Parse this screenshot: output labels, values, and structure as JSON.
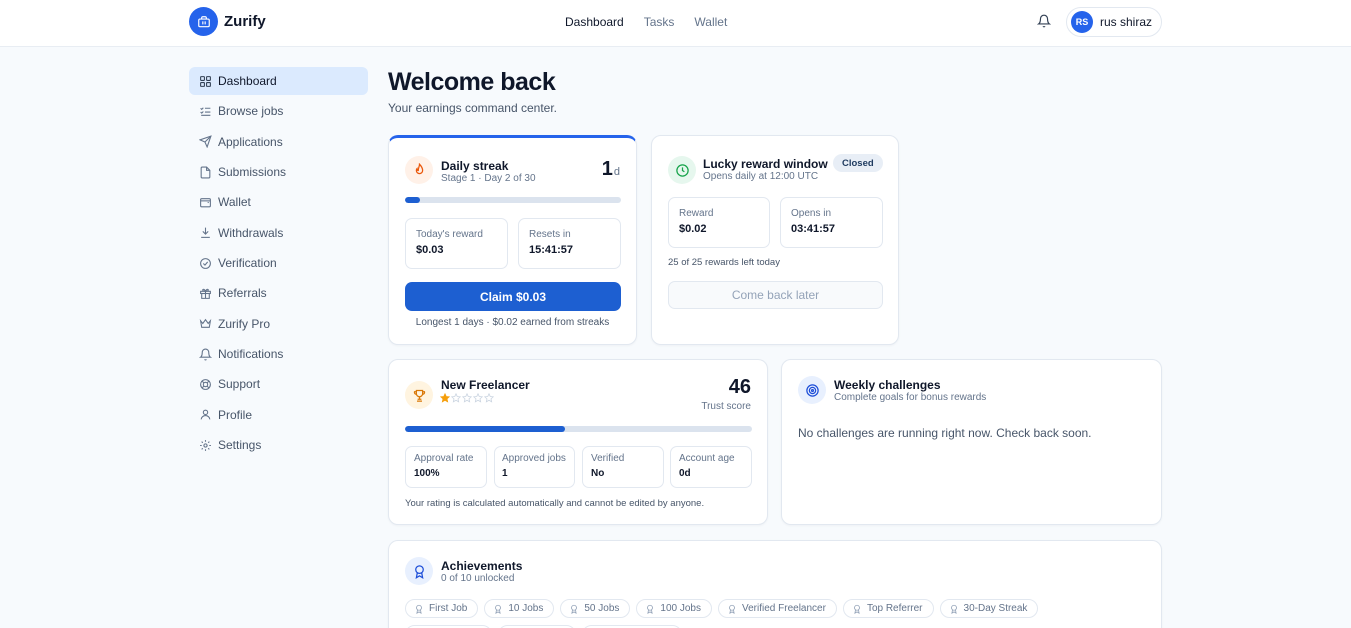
{
  "app": {
    "name": "Zurify"
  },
  "topnav": {
    "items": [
      "Dashboard",
      "Tasks",
      "Wallet"
    ],
    "active": 0
  },
  "user": {
    "initials": "RS",
    "name": "rus shiraz"
  },
  "sidebar": {
    "items": [
      {
        "label": "Dashboard",
        "icon": "grid-icon"
      },
      {
        "label": "Browse jobs",
        "icon": "list-check-icon"
      },
      {
        "label": "Applications",
        "icon": "send-icon"
      },
      {
        "label": "Submissions",
        "icon": "file-icon"
      },
      {
        "label": "Wallet",
        "icon": "wallet-icon"
      },
      {
        "label": "Withdrawals",
        "icon": "download-icon"
      },
      {
        "label": "Verification",
        "icon": "check-circle-icon"
      },
      {
        "label": "Referrals",
        "icon": "gift-icon"
      },
      {
        "label": "Zurify Pro",
        "icon": "crown-icon"
      },
      {
        "label": "Notifications",
        "icon": "bell-icon"
      },
      {
        "label": "Support",
        "icon": "lifebuoy-icon"
      },
      {
        "label": "Profile",
        "icon": "user-icon"
      },
      {
        "label": "Settings",
        "icon": "gear-icon"
      }
    ],
    "active": 0
  },
  "page": {
    "title": "Welcome back",
    "subtitle": "Your earnings command center."
  },
  "streak": {
    "title": "Daily streak",
    "subtitle": "Stage 1 · Day 2 of 30",
    "count": "1",
    "unit": "d",
    "progress": 0.07,
    "today_label": "Today's reward",
    "today_value": "$0.03",
    "resets_label": "Resets in",
    "resets_value": "15:41:57",
    "claim_label": "Claim $0.03",
    "footer": "Longest 1 days · $0.02 earned from streaks",
    "accent": "#2563eb"
  },
  "lucky": {
    "title": "Lucky reward window",
    "subtitle": "Opens daily at 12:00 UTC",
    "badge": "Closed",
    "reward_label": "Reward",
    "reward_value": "$0.02",
    "opens_label": "Opens in",
    "opens_value": "03:41:57",
    "remaining": "25 of 25 rewards left today",
    "button_label": "Come back later"
  },
  "freelancer": {
    "title": "New Freelancer",
    "stars_filled": 1,
    "stars_total": 5,
    "score": "46",
    "score_label": "Trust score",
    "progress": 0.46,
    "stats": [
      {
        "label": "Approval rate",
        "value": "100%"
      },
      {
        "label": "Approved jobs",
        "value": "1"
      },
      {
        "label": "Verified",
        "value": "No"
      },
      {
        "label": "Account age",
        "value": "0d"
      }
    ],
    "footer": "Your rating is calculated automatically and cannot be edited by anyone."
  },
  "weekly": {
    "title": "Weekly challenges",
    "subtitle": "Complete goals for bonus rewards",
    "empty": "No challenges are running right now. Check back soon."
  },
  "achievements": {
    "title": "Achievements",
    "subtitle": "0 of 10 unlocked",
    "chips": [
      "First Job",
      "10 Jobs",
      "50 Jobs",
      "100 Jobs",
      "Verified Freelancer",
      "Top Referrer",
      "30-Day Streak"
    ]
  },
  "colors": {
    "primary": "#1d5fd1",
    "brand": "#2563eb",
    "star": "#f59e0b",
    "lucky_green": "#16a34a"
  }
}
